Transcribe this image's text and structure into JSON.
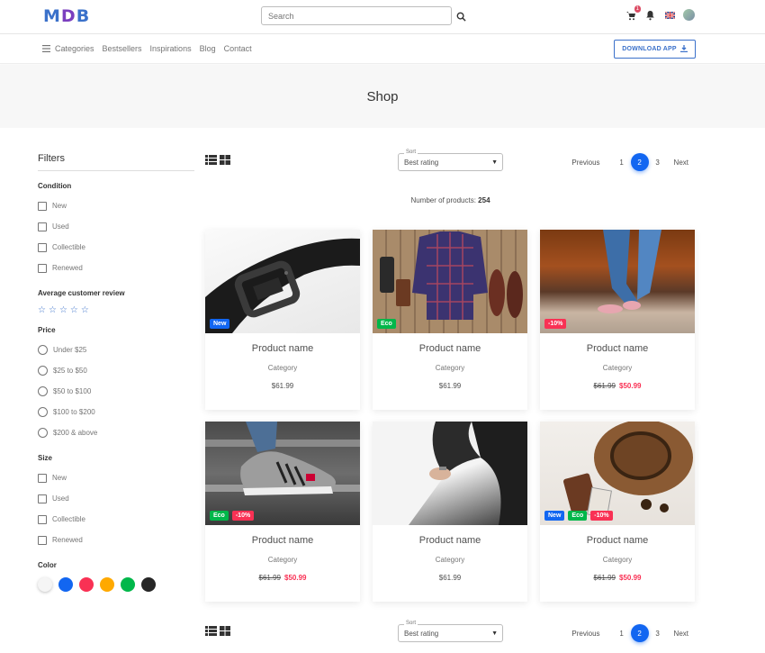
{
  "header": {
    "logo": "MDB",
    "search_placeholder": "Search",
    "cart_count": "1"
  },
  "nav": {
    "links": [
      "Categories",
      "Bestsellers",
      "Inspirations",
      "Blog",
      "Contact"
    ],
    "download_label": "DOWNLOAD APP"
  },
  "hero": {
    "title": "Shop"
  },
  "filters": {
    "title": "Filters",
    "condition": {
      "title": "Condition",
      "options": [
        "New",
        "Used",
        "Collectible",
        "Renewed"
      ]
    },
    "review": {
      "title": "Average customer review",
      "stars": 5
    },
    "price": {
      "title": "Price",
      "options": [
        "Under $25",
        "$25 to $50",
        "$50 to $100",
        "$100 to $200",
        "$200 & above"
      ]
    },
    "size": {
      "title": "Size",
      "options": [
        "New",
        "Used",
        "Collectible",
        "Renewed"
      ]
    },
    "color": {
      "title": "Color",
      "swatches": [
        "#f5f5f5",
        "#1266f1",
        "#f93154",
        "#ffa900",
        "#00b74a",
        "#262626"
      ]
    }
  },
  "toolbar": {
    "sort_label": "Sort",
    "sort_value": "Best rating",
    "pager": {
      "prev": "Previous",
      "pages": [
        "1",
        "2",
        "3"
      ],
      "active": "2",
      "next": "Next"
    }
  },
  "count": {
    "label": "Number of products:",
    "value": "254"
  },
  "products": [
    {
      "name": "Product name",
      "category": "Category",
      "price": "$61.99",
      "old_price": "",
      "badges": [
        "New"
      ],
      "image": "belt"
    },
    {
      "name": "Product name",
      "category": "Category",
      "price": "$61.99",
      "old_price": "",
      "badges": [
        "Eco"
      ],
      "image": "shirt"
    },
    {
      "name": "Product name",
      "category": "Category",
      "price": "$50.99",
      "old_price": "$61.99",
      "badges": [
        "-10%"
      ],
      "image": "rust"
    },
    {
      "name": "Product name",
      "category": "Category",
      "price": "$50.99",
      "old_price": "$61.99",
      "badges": [
        "Eco",
        "-10%"
      ],
      "image": "shoe"
    },
    {
      "name": "Product name",
      "category": "Category",
      "price": "$61.99",
      "old_price": "",
      "badges": [],
      "image": "white"
    },
    {
      "name": "Product name",
      "category": "Category",
      "price": "$50.99",
      "old_price": "$61.99",
      "badges": [
        "New",
        "Eco",
        "-10%"
      ],
      "image": "hat"
    }
  ],
  "colors": {
    "primary": "#1266f1",
    "success": "#00b74a",
    "danger": "#f93154",
    "brand": "#3b71ca"
  }
}
